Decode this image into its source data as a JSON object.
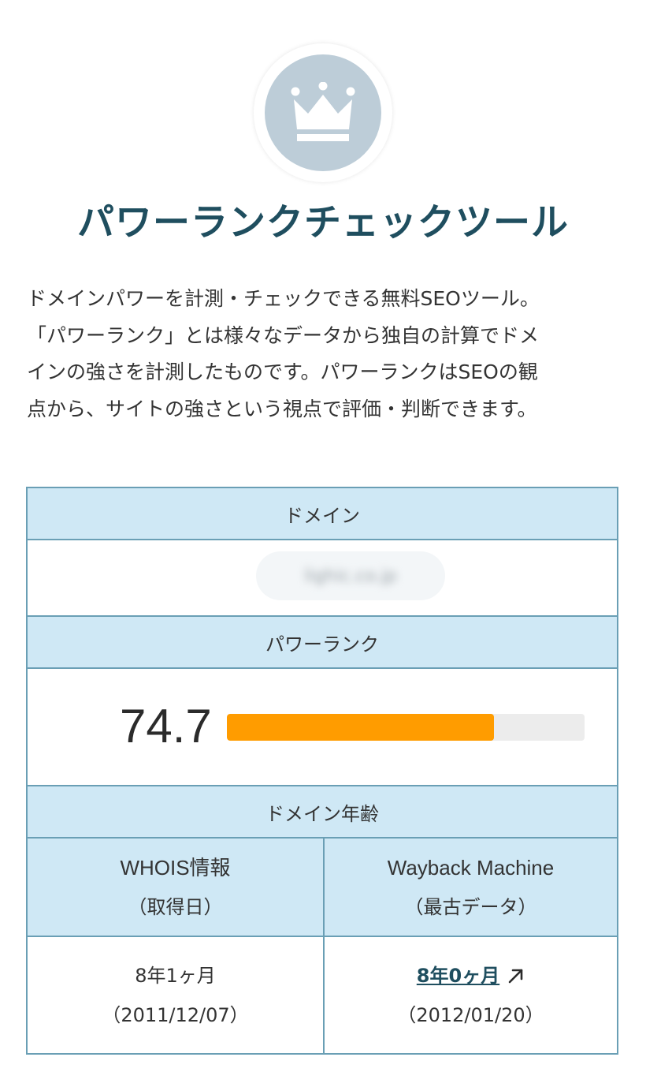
{
  "header": {
    "logo_icon": "crown-icon",
    "title": "パワーランクチェックツール"
  },
  "description": {
    "lines": [
      "ドメインパワーを計測・チェックできる無料SEOツール。",
      "「パワーランク」とは様々なデータから独自の計算でドメ",
      "インの強さを計測したものです。パワーランクはSEOの観",
      "点から、サイトの強さという視点で評価・判断できます。"
    ]
  },
  "result": {
    "domain_label": "ドメイン",
    "domain_value": "lighic.co.jp",
    "power_rank_label": "パワーランク",
    "power_rank_value": "74.7",
    "power_rank_fraction": 0.747,
    "domain_age_label": "ドメイン年齢",
    "whois": {
      "title": "WHOIS情報",
      "subtitle": "（取得日）",
      "age": "8年1ヶ月",
      "date": "（2011/12/07）"
    },
    "wayback": {
      "title": "Wayback Machine",
      "subtitle": "（最古データ）",
      "age": "8年0ヶ月",
      "link_icon": "external-link-arrow-icon",
      "date": "（2012/01/20）"
    }
  },
  "colors": {
    "title": "#1f4e5f",
    "header_bg": "#cfe8f5",
    "border": "#6a9fb5",
    "bar_fill": "#ff9c00",
    "bar_track": "#ececec",
    "logo_circle": "#bdcdd8"
  }
}
